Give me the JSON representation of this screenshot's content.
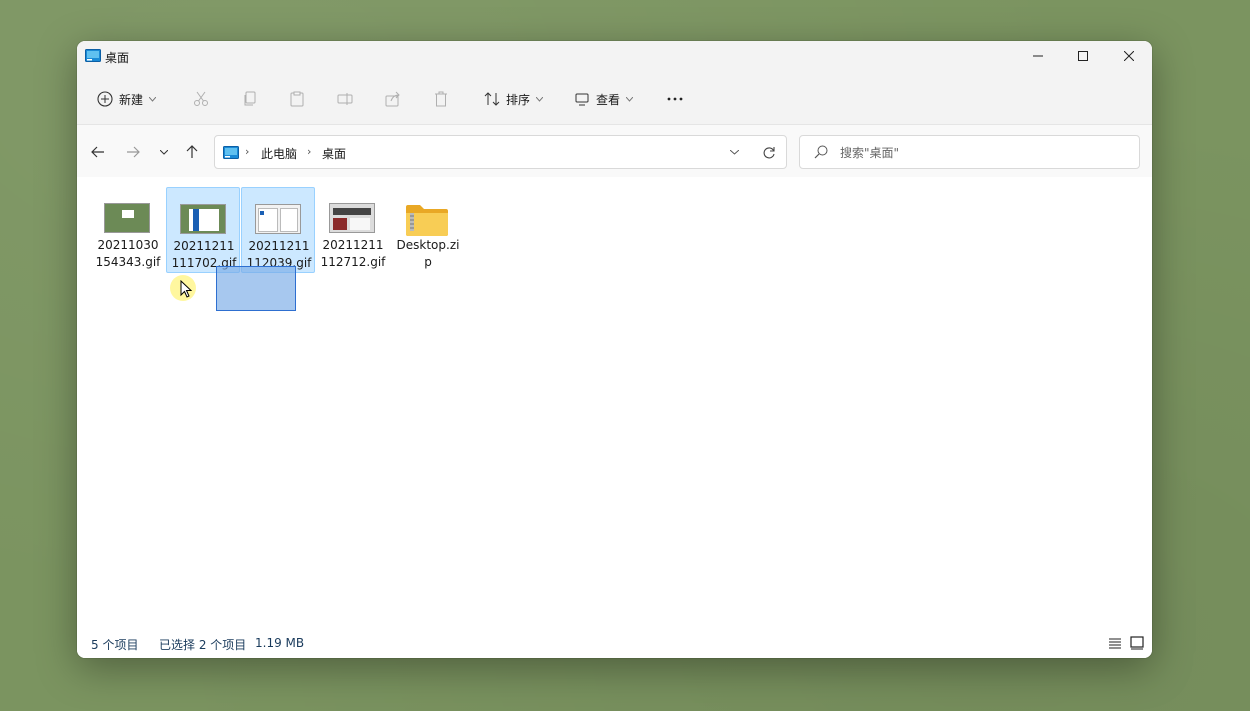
{
  "window": {
    "title": "桌面"
  },
  "toolbar": {
    "new_label": "新建",
    "sort_label": "排序",
    "view_label": "查看"
  },
  "breadcrumb": {
    "items": [
      "此电脑",
      "桌面"
    ]
  },
  "search": {
    "placeholder": "搜索\"桌面\""
  },
  "files": [
    {
      "line1": "20211030",
      "line2": "154343.gif",
      "selected": false
    },
    {
      "line1": "20211211",
      "line2": "111702.gif",
      "selected": true
    },
    {
      "line1": "20211211",
      "line2": "112039.gif",
      "selected": true
    },
    {
      "line1": "20211211",
      "line2": "112712.gif",
      "selected": false
    },
    {
      "line1": "Desktop.zi",
      "line2": "p",
      "selected": false
    }
  ],
  "status": {
    "count": "5 个项目",
    "selected": "已选择 2 个项目",
    "size": "1.19 MB"
  },
  "colors": {
    "desktop": "#7b9460",
    "selection": "#cce8ff",
    "selection_border": "#99d1ff",
    "drag_ghost": "#2e6fd0"
  }
}
